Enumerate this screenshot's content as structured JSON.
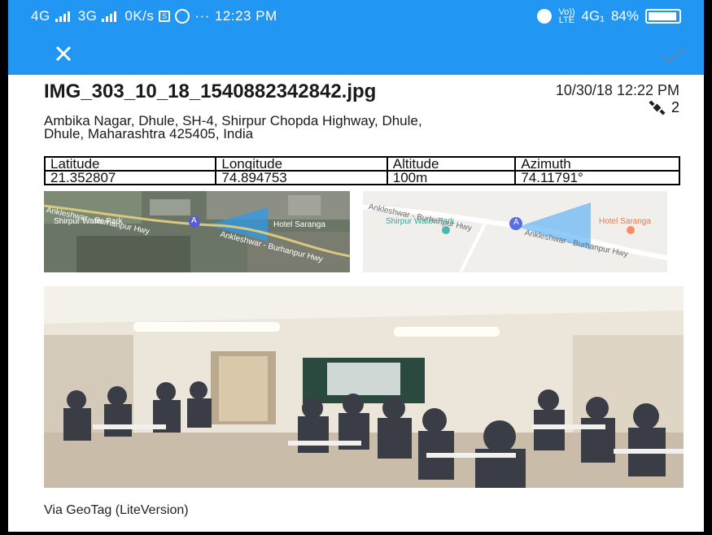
{
  "status_bar": {
    "left_text": [
      "4G",
      "3G",
      "0K/s"
    ],
    "more": "···",
    "time": "12:23 PM",
    "volte_top": "Vo))",
    "volte_bottom": "LTE",
    "network": "4G₁",
    "battery": "84%",
    "icons": [
      "signal-icon",
      "sim-icon",
      "whatsapp-icon",
      "alarm-icon",
      "battery-icon"
    ]
  },
  "app_bar": {
    "close_icon": "close-icon",
    "confirm_icon": "check-icon",
    "color": "#2196f3"
  },
  "photo_info": {
    "filename": "IMG_303_10_18_1540882342842.jpg",
    "datetime": "10/30/18 12:22 PM",
    "satellites": "2",
    "address": "Ambika Nagar, Dhule, SH-4, Shirpur Chopda Highway, Dhule, Dhule, Maharashtra 425405, India"
  },
  "geo_table": {
    "headers": [
      "Latitude",
      "Longitude",
      "Altitude",
      "Azimuth"
    ],
    "values": [
      "21.352807",
      "74.894753",
      "100m",
      "74.11791°"
    ]
  },
  "maps": {
    "satellite": {
      "road": "Ankleshwar - Burhanpur Hwy",
      "road2": "Ankleshwar - Burhanpur Hwy",
      "park": "Shirpur Water Park",
      "hotel": "Hotel Saranga",
      "marker": "A"
    },
    "roadmap": {
      "road": "Ankleshwar - Burhanpur Hwy",
      "road2": "Ankleshwar - Burhanpur Hwy",
      "park": "Shirpur Water Park",
      "hotel": "Hotel Saranga",
      "marker": "A"
    }
  },
  "footer": {
    "via": "Via GeoTag (LiteVersion)"
  }
}
